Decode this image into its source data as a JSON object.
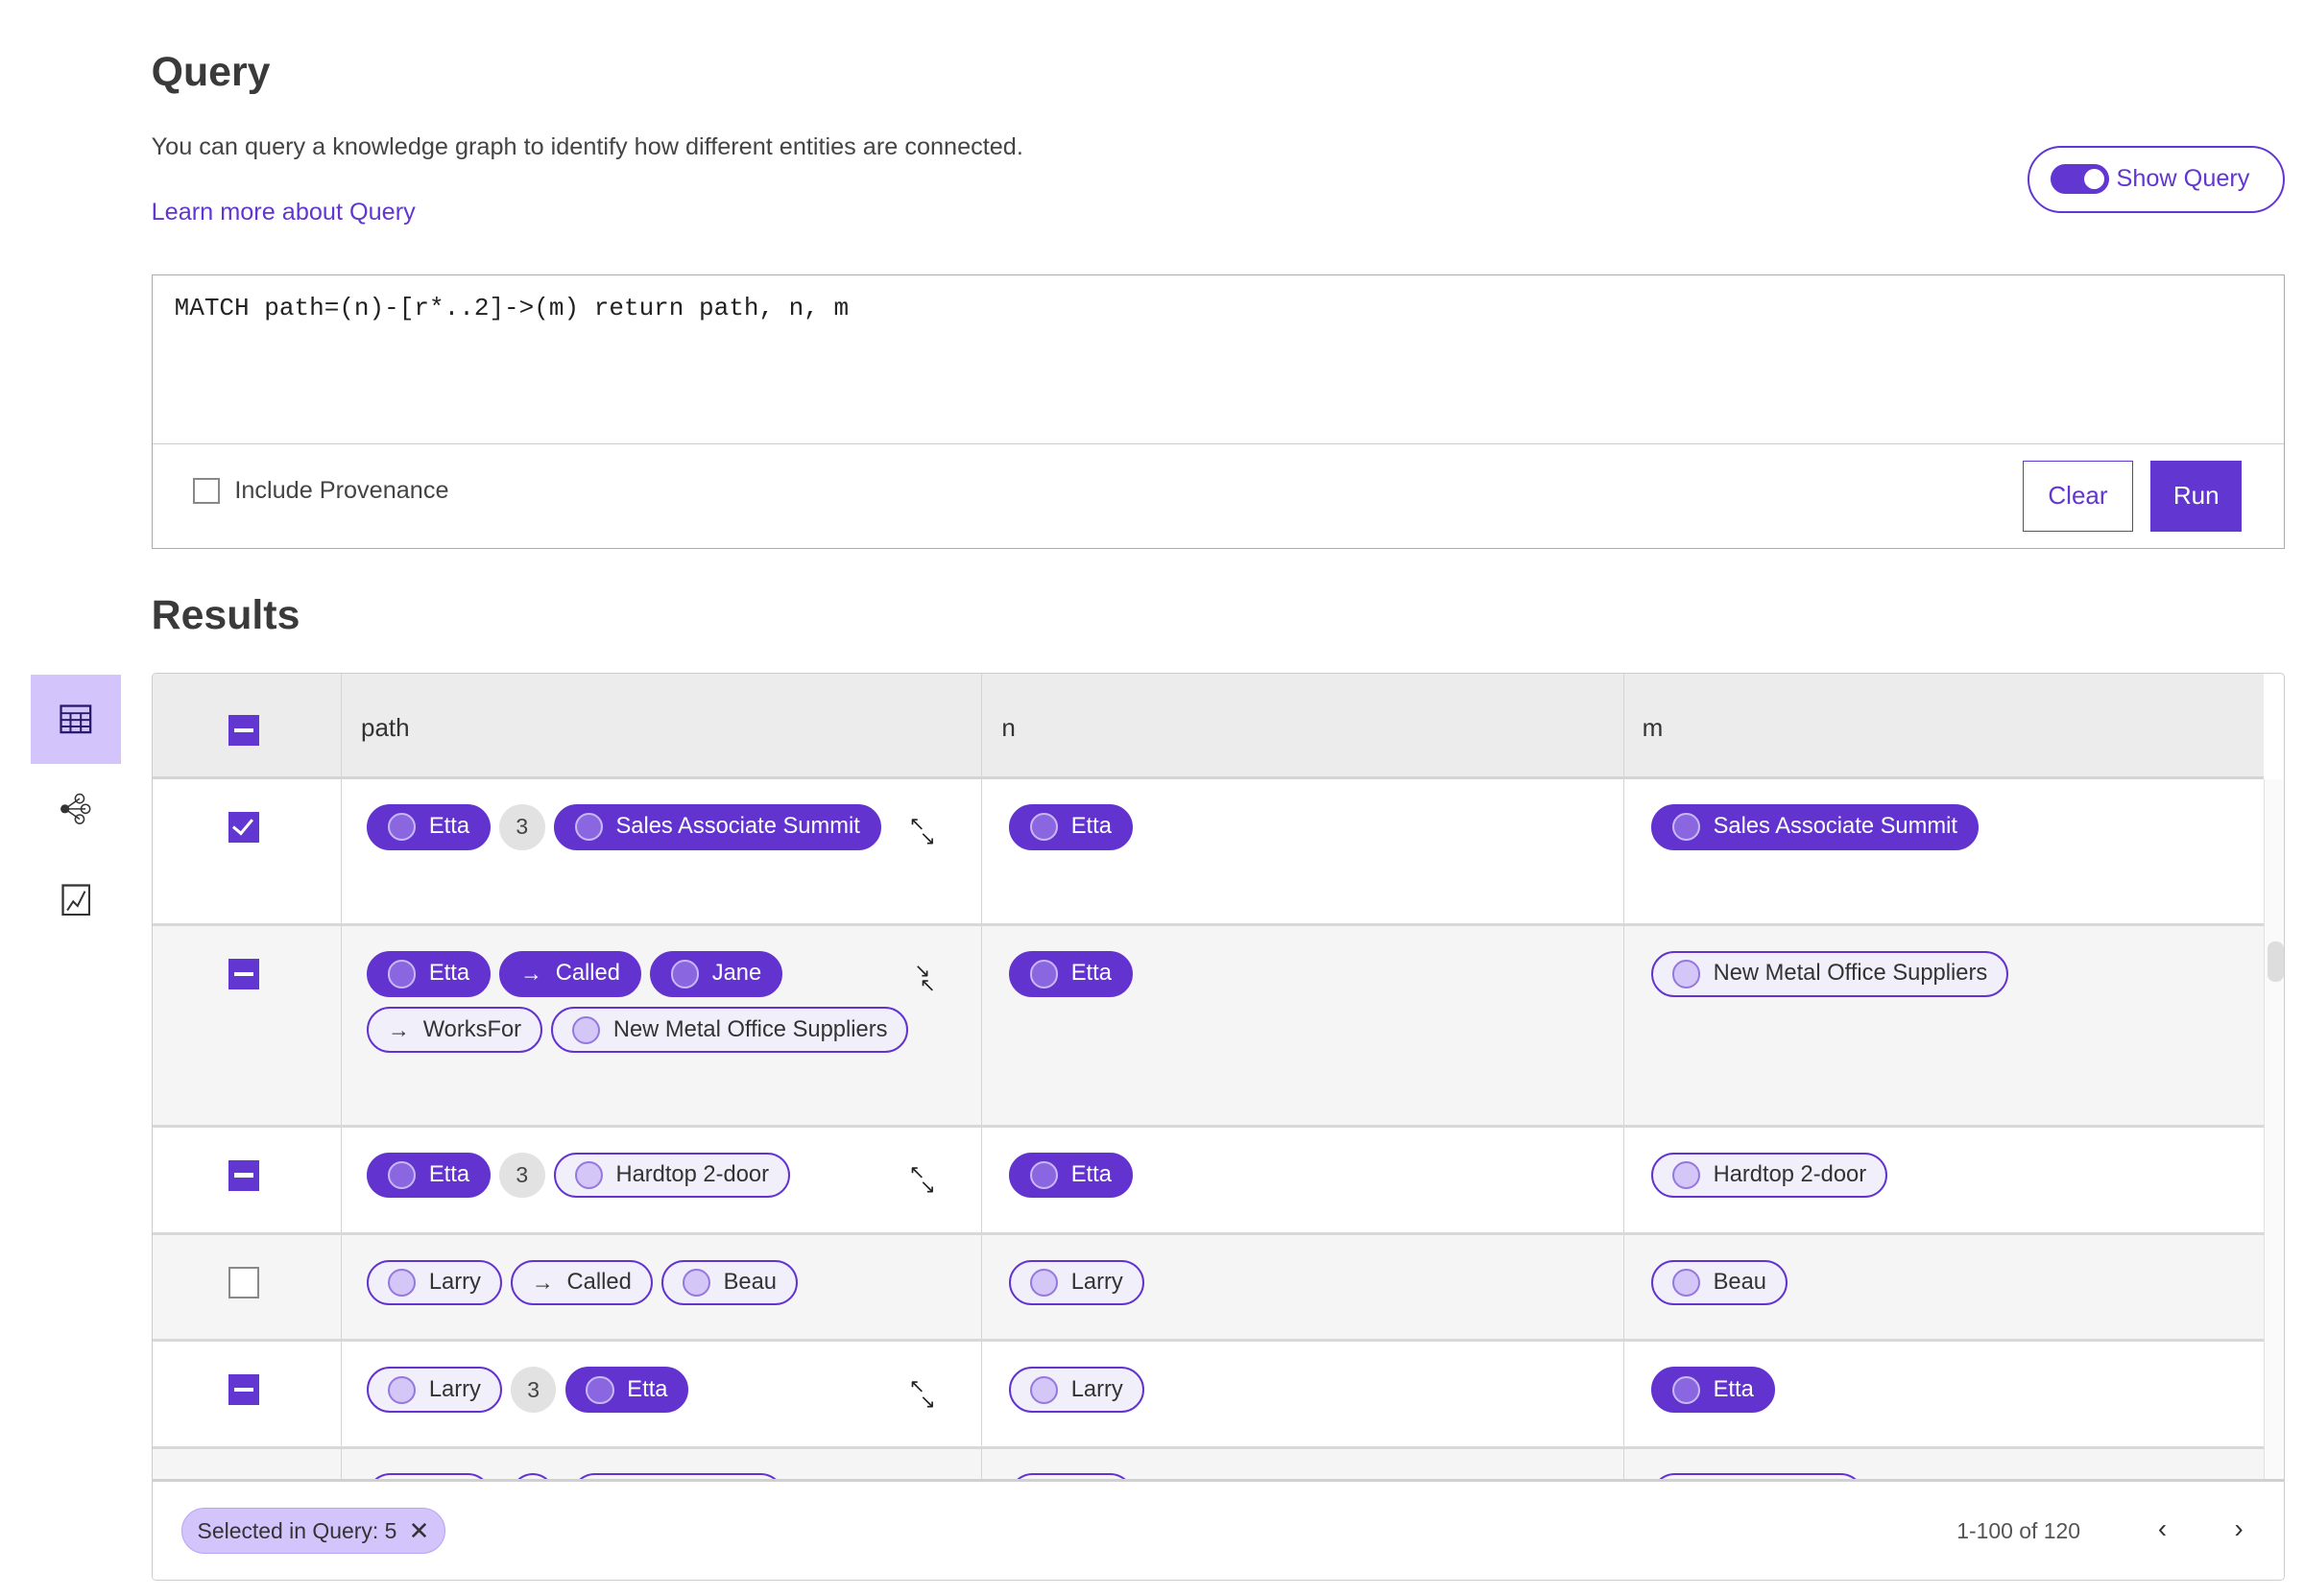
{
  "header": {
    "title": "Query",
    "description": "You can query a knowledge graph to identify how different entities are connected.",
    "learn_more": "Learn more about Query",
    "show_query_label": "Show Query",
    "show_query_on": true
  },
  "query": {
    "text": "MATCH path=(n)-[r*..2]->(m) return path, n, m",
    "include_provenance_label": "Include Provenance",
    "include_provenance": false,
    "clear_label": "Clear",
    "run_label": "Run"
  },
  "results": {
    "title": "Results",
    "columns": [
      "path",
      "n",
      "m"
    ]
  },
  "sidebar": {
    "items": [
      {
        "icon": "table-icon",
        "active": true
      },
      {
        "icon": "graph-icon",
        "active": false
      },
      {
        "icon": "chart-icon",
        "active": false
      }
    ]
  },
  "colors": {
    "accent": "#6236d1",
    "active_side": "#d4c4fc"
  },
  "rows": [
    {
      "check": "on",
      "expand": "expand",
      "path": [
        {
          "t": "node",
          "label": "Etta",
          "filled": true
        },
        {
          "t": "count",
          "label": "3"
        },
        {
          "t": "node",
          "label": "Sales Associate Summit",
          "filled": true
        }
      ],
      "n": {
        "label": "Etta",
        "filled": true
      },
      "m": {
        "label": "Sales Associate Summit",
        "filled": true
      }
    },
    {
      "check": "ind",
      "expand": "collapse",
      "path": [
        {
          "t": "node",
          "label": "Etta",
          "filled": true
        },
        {
          "t": "edge",
          "label": "Called",
          "filled": true
        },
        {
          "t": "node",
          "label": "Jane",
          "filled": true
        },
        {
          "t": "edge",
          "label": "WorksFor",
          "filled": false
        },
        {
          "t": "node",
          "label": "New Metal Office Suppliers",
          "filled": false
        }
      ],
      "n": {
        "label": "Etta",
        "filled": true
      },
      "m": {
        "label": "New Metal Office Suppliers",
        "filled": false
      }
    },
    {
      "check": "ind",
      "expand": "expand",
      "path": [
        {
          "t": "node",
          "label": "Etta",
          "filled": true
        },
        {
          "t": "count",
          "label": "3"
        },
        {
          "t": "node",
          "label": "Hardtop 2-door",
          "filled": false
        }
      ],
      "n": {
        "label": "Etta",
        "filled": true
      },
      "m": {
        "label": "Hardtop 2-door",
        "filled": false
      }
    },
    {
      "check": "off",
      "expand": "",
      "path": [
        {
          "t": "node",
          "label": "Larry",
          "filled": false
        },
        {
          "t": "edge",
          "label": "Called",
          "filled": false
        },
        {
          "t": "node",
          "label": "Beau",
          "filled": false
        }
      ],
      "n": {
        "label": "Larry",
        "filled": false
      },
      "m": {
        "label": "Beau",
        "filled": false
      }
    },
    {
      "check": "ind",
      "expand": "expand",
      "path": [
        {
          "t": "node",
          "label": "Larry",
          "filled": false
        },
        {
          "t": "count",
          "label": "3"
        },
        {
          "t": "node",
          "label": "Etta",
          "filled": true
        }
      ],
      "n": {
        "label": "Larry",
        "filled": false
      },
      "m": {
        "label": "Etta",
        "filled": true
      }
    }
  ],
  "footer": {
    "selected_label": "Selected in Query: 5",
    "range": "1-100 of 120"
  }
}
